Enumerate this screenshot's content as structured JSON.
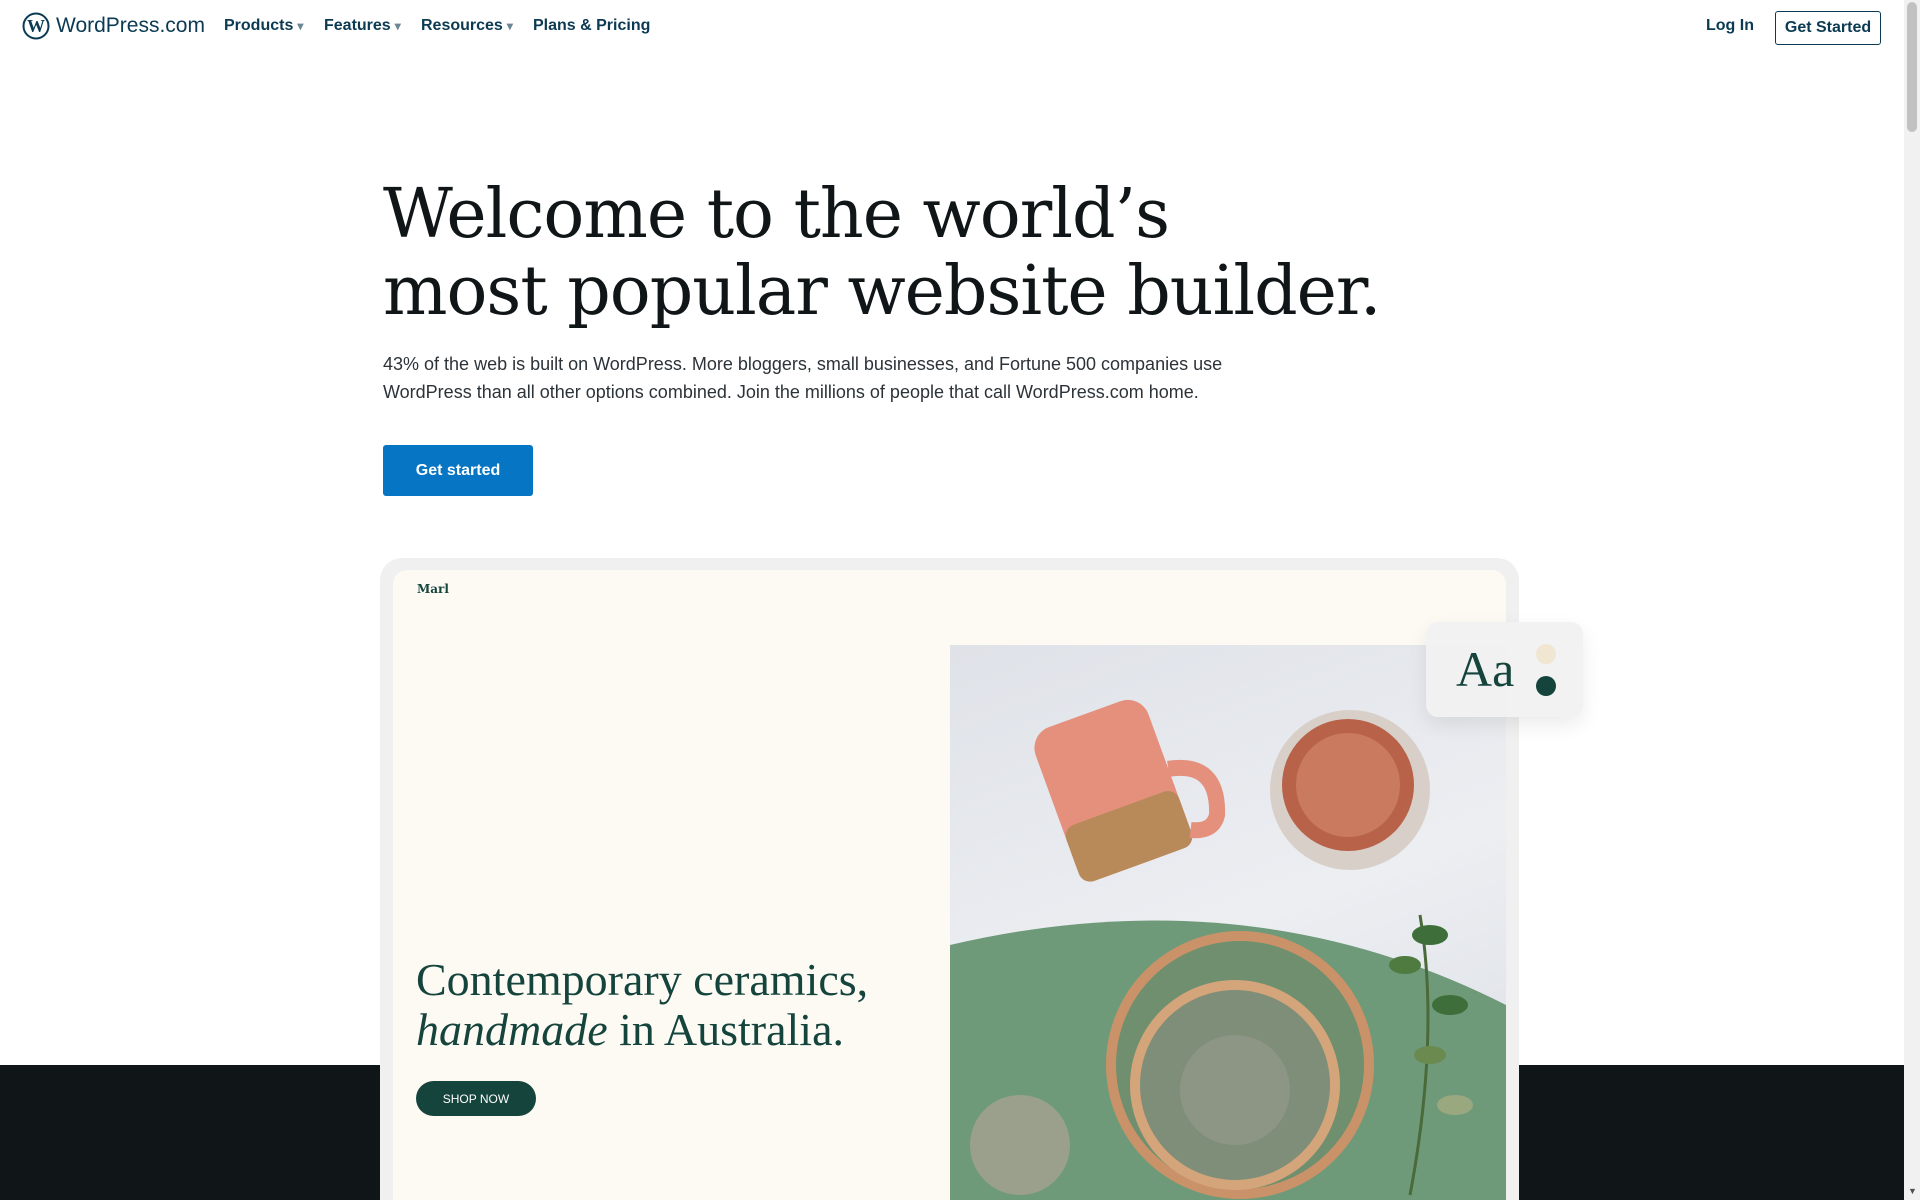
{
  "nav": {
    "brand": "WordPress.com",
    "items": [
      {
        "label": "Products",
        "dropdown": true
      },
      {
        "label": "Features",
        "dropdown": true
      },
      {
        "label": "Resources",
        "dropdown": true
      },
      {
        "label": "Plans & Pricing",
        "dropdown": false
      }
    ],
    "login": "Log In",
    "get_started": "Get Started",
    "caret": "▾"
  },
  "hero": {
    "title_line1": "Welcome to the world’s",
    "title_line2": "most popular website builder.",
    "lead": "43% of the web is built on WordPress. More bloggers, small businesses, and Fortune 500 companies use WordPress than all other options combined. Join the millions of people that call WordPress.com home.",
    "cta": "Get started"
  },
  "preview": {
    "site_name": "Marl",
    "heading_line1": "Contemporary ceramics,",
    "heading_em": "handmade",
    "heading_rest": " in Australia.",
    "shop_button": "SHOP NOW",
    "font_sample": "Aa",
    "palette": [
      "#f0e6d2",
      "#14443c"
    ]
  },
  "colors": {
    "accent": "#0675c4",
    "navy": "#0b3a52",
    "dark_band": "#101517"
  }
}
